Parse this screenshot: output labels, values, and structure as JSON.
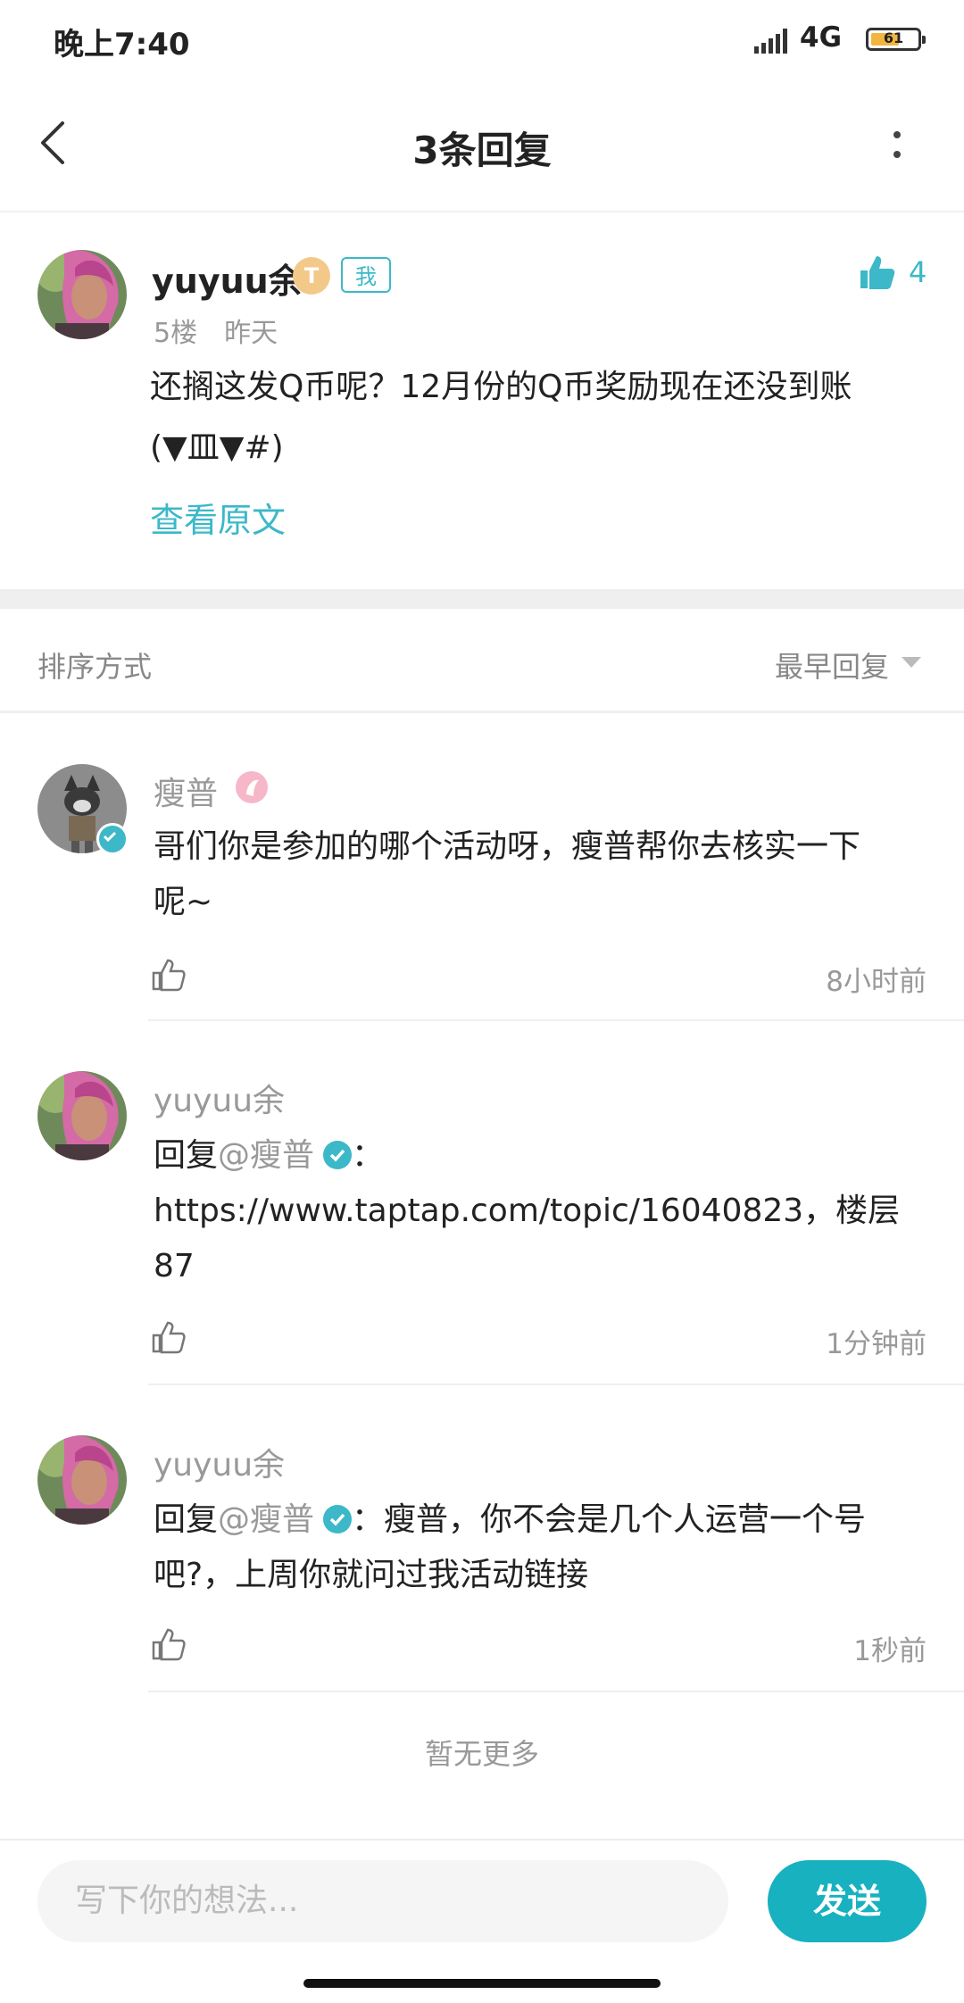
{
  "status_bar": {
    "time": "晚上7:40",
    "network": "4G",
    "battery": "61",
    "battery_level": 0.61
  },
  "nav": {
    "title": "3条回复"
  },
  "main_post": {
    "author": "yuyuu余",
    "level_badge": "T",
    "me_badge": "我",
    "likes": "4",
    "floor": "5楼",
    "time": "昨天",
    "text_line1": "还搁这发Q币呢？12月份的Q币奖励现在还没到账",
    "text_line2": "(▼皿▼#)",
    "view_original": "查看原文"
  },
  "sort": {
    "label": "排序方式",
    "selected": "最早回复"
  },
  "replies": [
    {
      "author": "瘦普",
      "text_line1": "哥们你是参加的哪个活动呀，瘦普帮你去核实一下",
      "text_line2": "呢~",
      "time": "8小时前"
    },
    {
      "author": "yuyuu余",
      "prefix": "回复",
      "mention": "@瘦普",
      "text_line1_suffix": "：",
      "text_line2": "https://www.taptap.com/topic/16040823，楼层",
      "text_line3": "87",
      "time": "1分钟前"
    },
    {
      "author": "yuyuu余",
      "prefix": "回复",
      "mention": "@瘦普",
      "text_line1_suffix": "：瘦普，你不会是几个人运营一个号",
      "text_line2": "吧?，上周你就问过我活动链接",
      "time": "1秒前"
    }
  ],
  "no_more": "暂无更多",
  "composer": {
    "placeholder": "写下你的想法...",
    "send_label": "发送"
  },
  "colors": {
    "accent": "#17b1c0",
    "mention_blue": "#3cb8c8",
    "muted": "#999999"
  },
  "icons": [
    "back-arrow-icon",
    "more-vertical-icon",
    "thumbs-up-icon",
    "verified-check-icon",
    "dropdown-triangle-icon",
    "signal-icon",
    "battery-icon"
  ]
}
